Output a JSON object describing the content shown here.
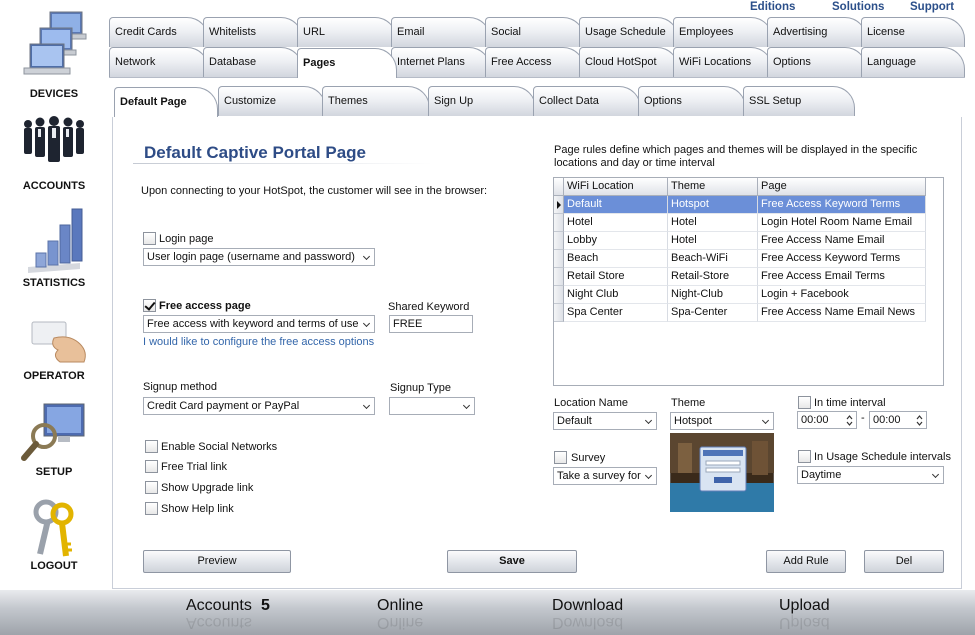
{
  "top_links": {
    "editions": "Editions",
    "solutions": "Solutions",
    "support": "Support"
  },
  "left_nav": [
    {
      "key": "devices",
      "label": "DEVICES",
      "icon": "devices-icon"
    },
    {
      "key": "accounts",
      "label": "ACCOUNTS",
      "icon": "people-icon"
    },
    {
      "key": "statistics",
      "label": "STATISTICS",
      "icon": "bar-chart-icon"
    },
    {
      "key": "operator",
      "label": "OPERATOR",
      "icon": "card-hand-icon"
    },
    {
      "key": "setup",
      "label": "SETUP",
      "icon": "monitor-magnifier-icon"
    },
    {
      "key": "logout",
      "label": "LOGOUT",
      "icon": "keys-icon"
    }
  ],
  "tabs_row1": [
    "Credit Cards",
    "Whitelists",
    "URL",
    "Email",
    "Social",
    "Usage Schedule",
    "Employees",
    "Advertising",
    "License"
  ],
  "tabs_row2": [
    "Network",
    "Database",
    "Pages",
    "Internet Plans",
    "Free Access",
    "Cloud HotSpot",
    "WiFi Locations",
    "Options",
    "Language"
  ],
  "tabs_row3": [
    "Default Page",
    "Customize",
    "Themes",
    "Sign Up",
    "Collect Data",
    "Options",
    "SSL Setup"
  ],
  "active_tab_row2": "Pages",
  "active_tab_row3": "Default Page",
  "panel": {
    "title": "Default Captive Portal Page",
    "intro": "Upon connecting to your HotSpot, the customer will see in the browser:",
    "login_page": {
      "label": "Login page",
      "checked": false,
      "select_value": "User login page (username and password)"
    },
    "free_access": {
      "label": "Free access page",
      "checked": true,
      "select_value": "Free access with keyword and terms of use",
      "config_link": "I would like to configure the free access options",
      "keyword_label": "Shared Keyword",
      "keyword_value": "FREE"
    },
    "signup": {
      "method_label": "Signup method",
      "method_value": "Credit Card payment or PayPal",
      "type_label": "Signup Type",
      "type_value": ""
    },
    "options": [
      {
        "label": "Enable Social Networks",
        "checked": false
      },
      {
        "label": "Free Trial link",
        "checked": false
      },
      {
        "label": "Show Upgrade link",
        "checked": false
      },
      {
        "label": "Show Help link",
        "checked": false
      }
    ],
    "rules_desc": "Page rules define which pages and themes will be displayed in the specific locations and day or time interval",
    "grid": {
      "columns": [
        "WiFi Location",
        "Theme",
        "Page"
      ],
      "rows": [
        [
          "Default",
          "Hotspot",
          "Free Access Keyword Terms"
        ],
        [
          "Hotel",
          "Hotel",
          "Login Hotel Room Name Email"
        ],
        [
          "Lobby",
          "Hotel",
          "Free Access Name Email"
        ],
        [
          "Beach",
          "Beach-WiFi",
          "Free Access Keyword Terms"
        ],
        [
          "Retail Store",
          "Retail-Store",
          "Free Access Email Terms"
        ],
        [
          "Night Club",
          "Night-Club",
          "Login + Facebook"
        ],
        [
          "Spa Center",
          "Spa-Center",
          "Free Access Name Email News"
        ]
      ],
      "selected_row": 0
    },
    "location_label": "Location Name",
    "location_value": "Default",
    "theme_label": "Theme",
    "theme_value": "Hotspot",
    "time_interval": {
      "label": "In time interval",
      "checked": false,
      "from": "00:00",
      "dash": "-",
      "to": "00:00"
    },
    "survey": {
      "label": "Survey",
      "checked": false,
      "select_value": "Take a survey for"
    },
    "usage_schedule": {
      "label": "In Usage Schedule intervals",
      "checked": false,
      "select_value": "Daytime"
    },
    "buttons": {
      "preview": "Preview",
      "save": "Save",
      "add_rule": "Add Rule",
      "del": "Del"
    }
  },
  "status": {
    "accounts_label": "Accounts",
    "accounts_value": "5",
    "online_label": "Online",
    "download_label": "Download",
    "upload_label": "Upload"
  }
}
